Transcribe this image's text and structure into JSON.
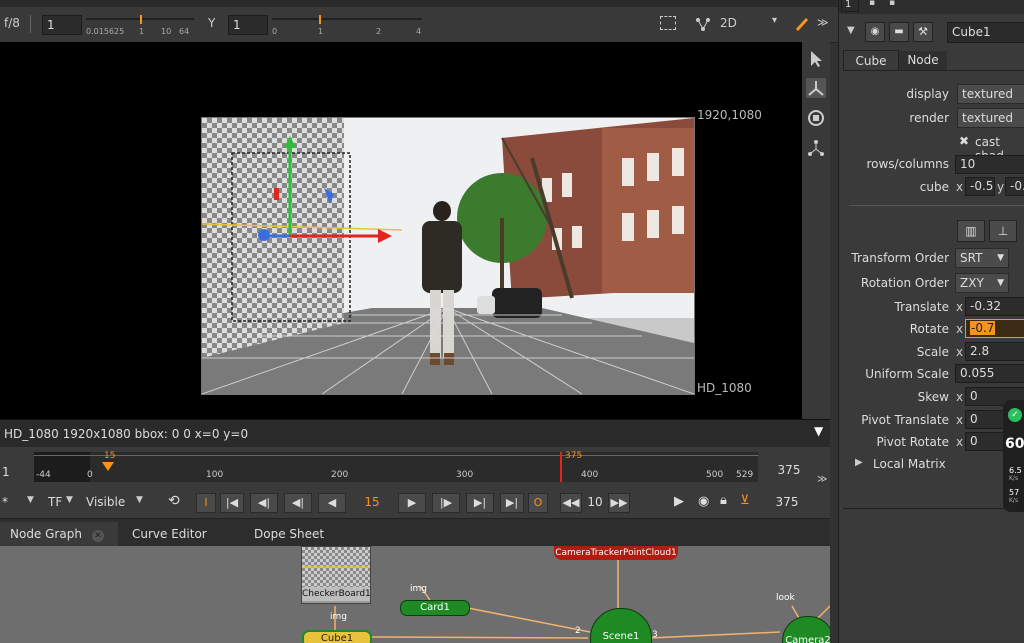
{
  "viewer_toolbar": {
    "fstop": "f/8",
    "gain_value": "1",
    "gain_ticks": [
      "0.015625",
      "1",
      "10",
      "64"
    ],
    "gamma_label": "Y",
    "gamma_value": "1",
    "gamma_ticks": [
      "0",
      "1",
      "2",
      "4"
    ],
    "view_mode": "2D"
  },
  "viewer": {
    "format_top": "1920,1080",
    "format_bottom": "HD_1080",
    "status": "HD_1080 1920x1080  bbox: 0 0  x=0 y=0"
  },
  "timeline": {
    "left_frame": "1",
    "current_marker": "15",
    "out_marker": "375",
    "right_frame": "375",
    "ticks": [
      "-44",
      "0",
      "100",
      "200",
      "300",
      "400",
      "500",
      "529"
    ]
  },
  "playback": {
    "tf_label": "TF",
    "visible_label": "Visible",
    "in_label": "I",
    "out_label": "O",
    "current_frame": "15",
    "step": "10",
    "end_frame": "375"
  },
  "tabs": [
    {
      "label": "Node Graph"
    },
    {
      "label": "Curve Editor"
    },
    {
      "label": "Dope Sheet"
    }
  ],
  "nodes": {
    "camera_tracker": "CameraTrackerPointCloud1",
    "checkerboard": "CheckerBoard1",
    "card": "Card1",
    "card_input": "img",
    "cube": "Cube1",
    "cube_input": "img",
    "scene": "Scene1",
    "scene_in_a": "2",
    "scene_in_b": "3",
    "camera": "Camera2",
    "camera_input": "look"
  },
  "properties": {
    "top_field": "1",
    "node_name": "Cube1",
    "tabs": [
      "Cube",
      "Node"
    ],
    "display_label": "display",
    "display_value": "textured",
    "render_label": "render",
    "render_value": "textured",
    "cast_shadow": "cast shad",
    "rows_columns_label": "rows/columns",
    "rows_columns_value": "10",
    "cube_label": "cube",
    "cube_x": "-0.5",
    "cube_y": "-0.",
    "transform_order_label": "Transform Order",
    "transform_order_value": "SRT",
    "rotation_order_label": "Rotation Order",
    "rotation_order_value": "ZXY",
    "translate_label": "Translate",
    "translate_x": "-0.32",
    "rotate_label": "Rotate",
    "rotate_x": "-0.7",
    "scale_label": "Scale",
    "scale_x": "2.8",
    "uniform_scale_label": "Uniform Scale",
    "uniform_scale_value": "0.055",
    "skew_label": "Skew",
    "skew_x": "0",
    "pivot_translate_label": "Pivot Translate",
    "pivot_translate_x": "0",
    "pivot_rotate_label": "Pivot Rotate",
    "pivot_rotate_x": "0",
    "local_matrix_label": "Local Matrix",
    "axis_x": "x",
    "axis_y": "y",
    "badge_value": "60",
    "badge_a": "6.5",
    "badge_b": "57",
    "badge_unit": "K/s"
  },
  "colors": {
    "accent_orange": "#f7931e",
    "node_green": "#1f8a24",
    "node_red": "#b01c0f",
    "cube_yellow": "#e8c23a"
  }
}
